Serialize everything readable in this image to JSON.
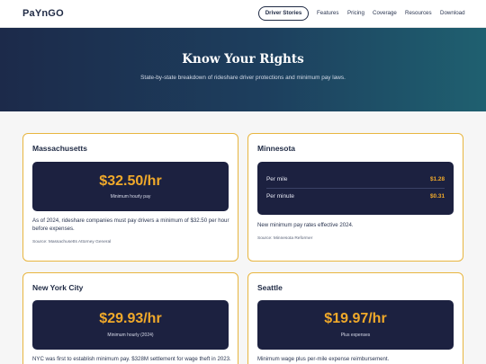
{
  "nav": {
    "logo": "PaYnGO",
    "active": "Driver Stories",
    "links": [
      "Features",
      "Pricing",
      "Coverage",
      "Resources",
      "Download"
    ]
  },
  "hero": {
    "title": "Know Your Rights",
    "subtitle": "State-by-state breakdown of rideshare driver protections and minimum pay laws."
  },
  "cards": {
    "massachusetts": {
      "title": "Massachusetts",
      "amount": "$32.50/hr",
      "amount_label": "Minimum hourly pay",
      "description": "As of 2024, rideshare companies must pay drivers a minimum of $32.50 per hour before expenses.",
      "source": "Source: Massachusetts Attorney General"
    },
    "minnesota": {
      "title": "Minnesota",
      "rates": [
        {
          "label": "Per mile",
          "value": "$1.28"
        },
        {
          "label": "Per minute",
          "value": "$0.31"
        }
      ],
      "description": "New minimum pay rates effective 2024.",
      "source": "Source: Minnesota Reformer"
    },
    "nyc": {
      "title": "New York City",
      "amount": "$29.93/hr",
      "amount_label": "Minimum hourly (2024)",
      "description": "NYC was first to establish minimum pay. $328M settlement for wage theft in 2023."
    },
    "seattle": {
      "title": "Seattle",
      "amount": "$19.97/hr",
      "amount_label": "Plus expenses",
      "description": "Minimum wage plus per-mile expense reimbursement."
    }
  },
  "colors": {
    "accent": "#f0a92a",
    "card_border": "#e8b640",
    "panel": "#1c2140",
    "hero_start": "#1c2a4a",
    "hero_end": "#1f6070"
  }
}
